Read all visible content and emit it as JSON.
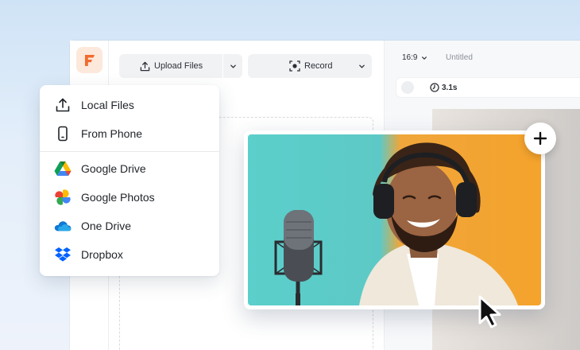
{
  "toolbar": {
    "upload_label": "Upload Files",
    "record_label": "Record"
  },
  "canvas": {
    "aspect_ratio": "16:9",
    "title": "Untitled",
    "duration": "3.1s"
  },
  "upload_menu": {
    "items": [
      {
        "label": "Local Files",
        "icon": "upload-icon"
      },
      {
        "label": "From Phone",
        "icon": "phone-icon"
      }
    ],
    "cloud_items": [
      {
        "label": "Google Drive",
        "icon": "google-drive-icon"
      },
      {
        "label": "Google Photos",
        "icon": "google-photos-icon"
      },
      {
        "label": "One Drive",
        "icon": "onedrive-icon"
      },
      {
        "label": "Dropbox",
        "icon": "dropbox-icon"
      }
    ]
  },
  "colors": {
    "brand": "#f26b2e",
    "photo_left": "#5ccfcb",
    "photo_right": "#f4a32c"
  }
}
